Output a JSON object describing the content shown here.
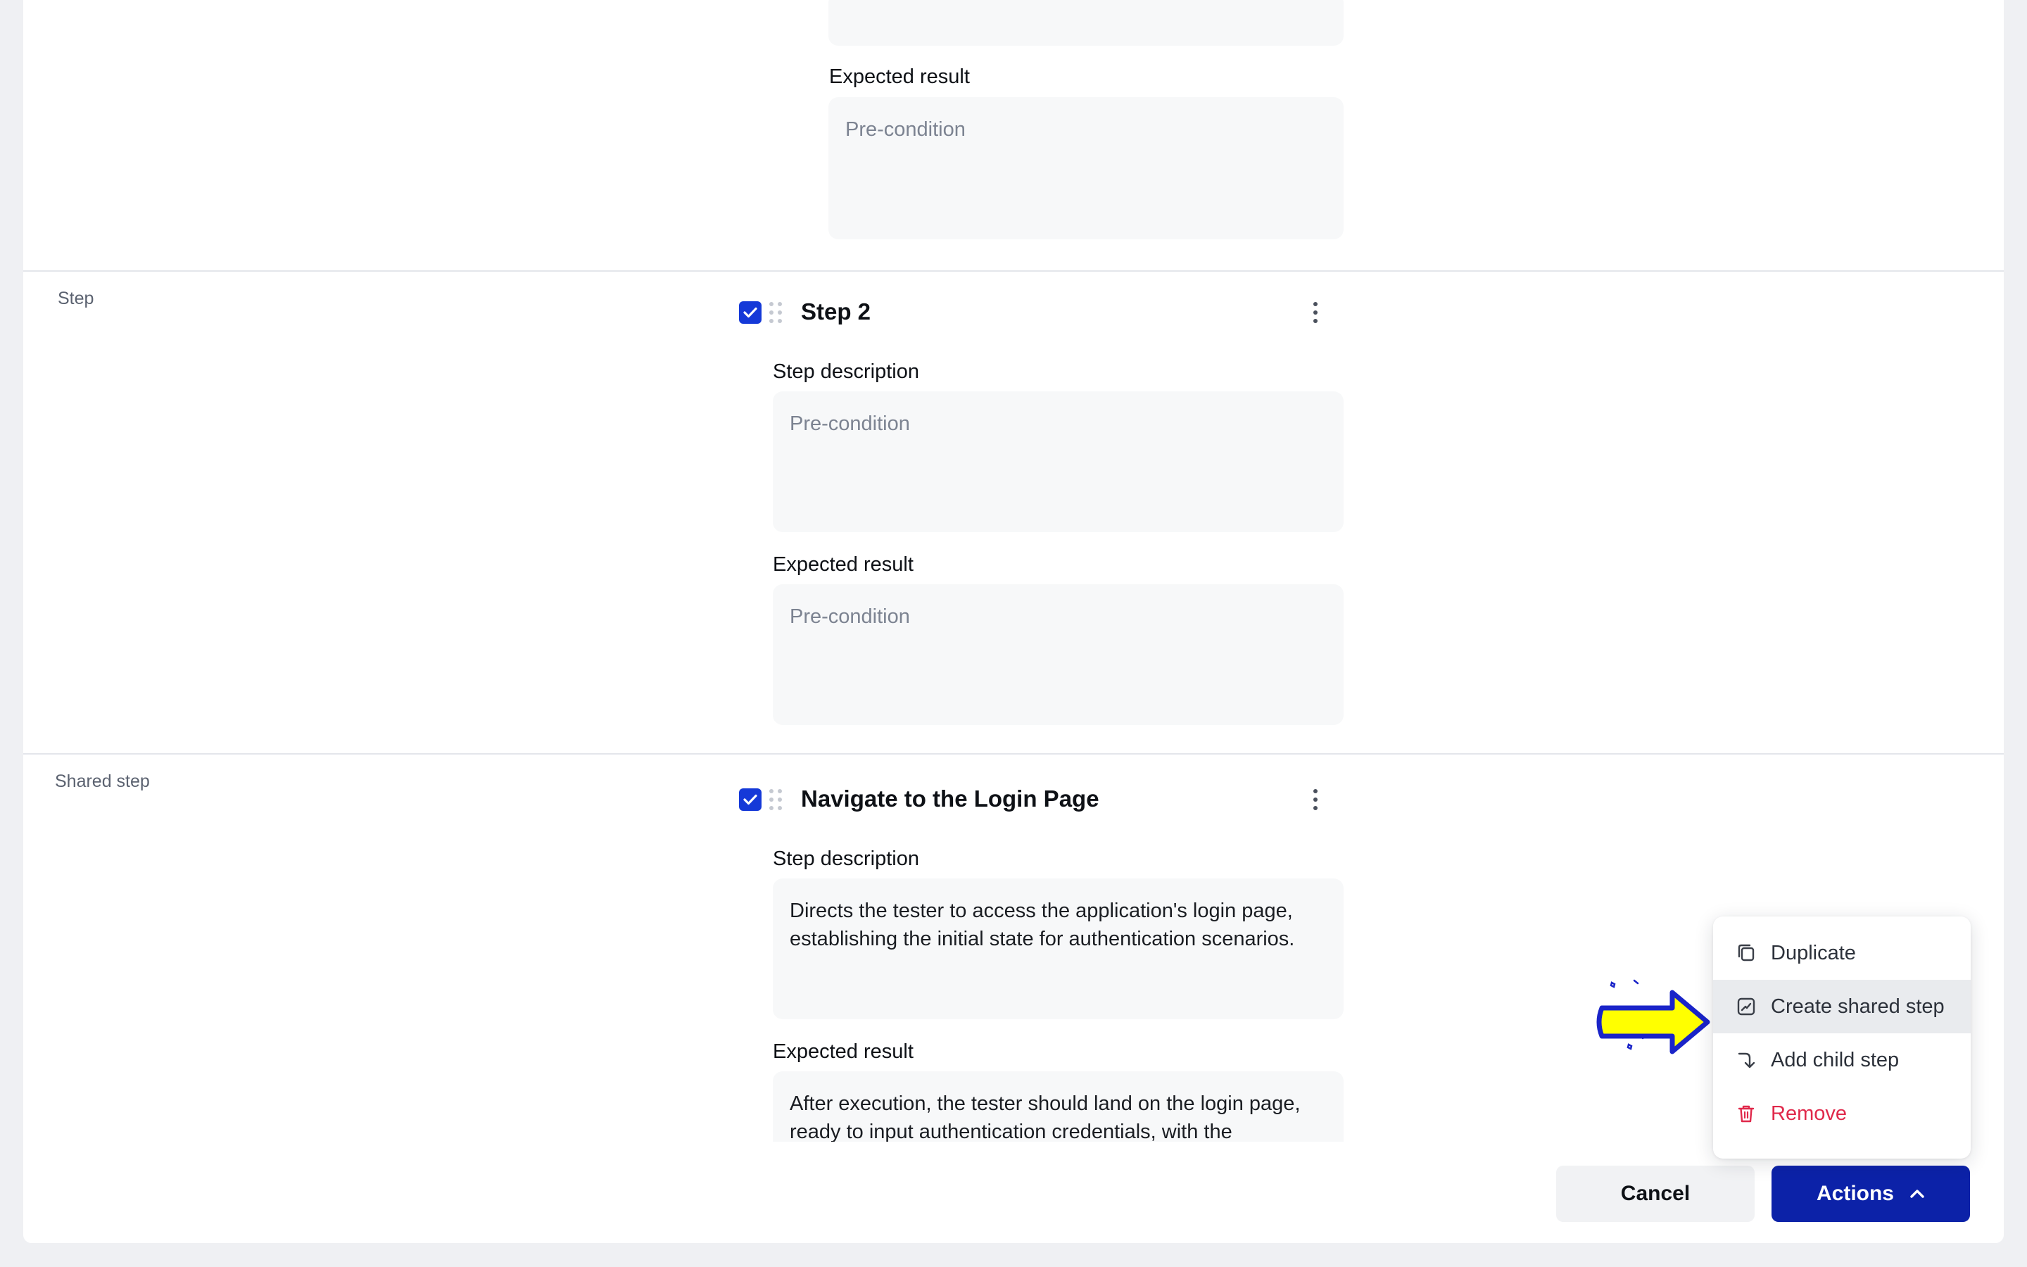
{
  "top_section": {
    "expected_result_label": "Expected result",
    "expected_result_placeholder": "Pre-condition"
  },
  "step_section": {
    "type_label": "Step",
    "checked": true,
    "title": "Step 2",
    "description_label": "Step description",
    "description_placeholder": "Pre-condition",
    "expected_result_label": "Expected result",
    "expected_result_placeholder": "Pre-condition"
  },
  "shared_step_section": {
    "type_label": "Shared step",
    "checked": true,
    "title": "Navigate to the Login Page",
    "description_label": "Step description",
    "description_value": "Directs the tester to access the application's login page, establishing the initial state for authentication scenarios.",
    "expected_result_label": "Expected result",
    "expected_result_value": "After execution, the tester should land on the login page, ready to input authentication credentials, with the"
  },
  "actions_menu": {
    "items": [
      {
        "label": "Duplicate",
        "icon": "duplicate-icon"
      },
      {
        "label": "Create shared step",
        "icon": "shared-step-icon",
        "highlighted": true
      },
      {
        "label": "Add child step",
        "icon": "child-step-icon"
      },
      {
        "label": "Remove",
        "icon": "trash-icon",
        "danger": true
      }
    ]
  },
  "footer": {
    "cancel_label": "Cancel",
    "actions_label": "Actions"
  },
  "colors": {
    "primary": "#0c22a8",
    "checkbox": "#1539d8",
    "danger": "#e0294b",
    "pointer_fill": "#ffff00",
    "pointer_stroke": "#1a24c8"
  }
}
